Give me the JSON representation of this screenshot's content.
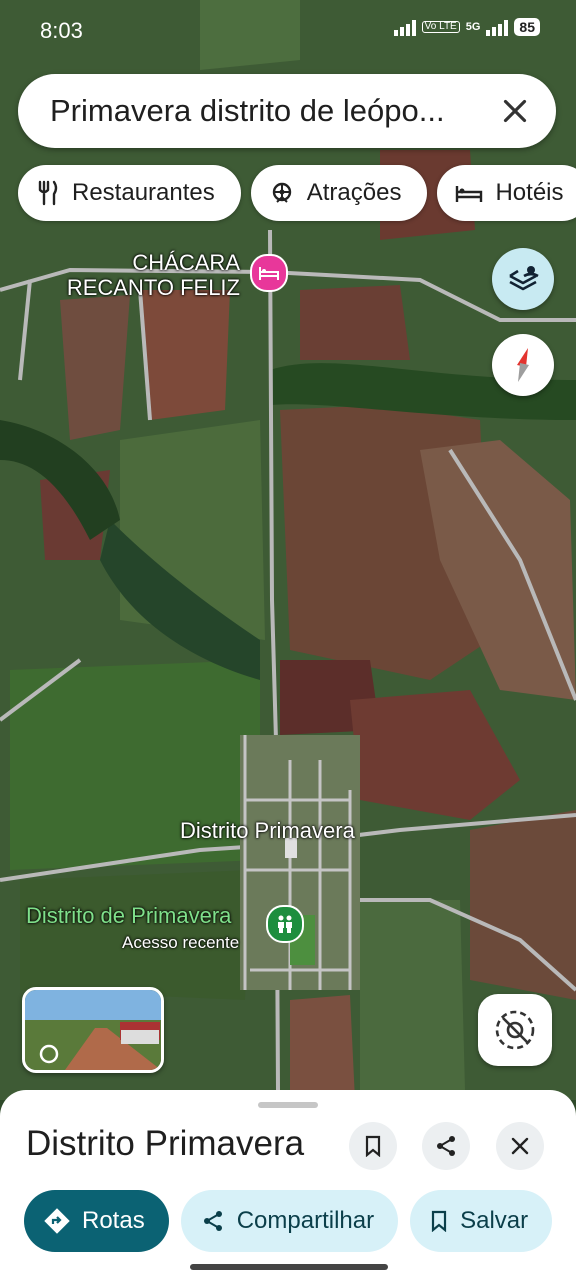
{
  "status": {
    "time": "8:03",
    "volte": "Vo LTE",
    "network": "5G",
    "battery": "85"
  },
  "search": {
    "query": "Primavera distrito de leópo..."
  },
  "chips": [
    {
      "label": "Restaurantes",
      "icon": "fork-knife-icon"
    },
    {
      "label": "Atrações",
      "icon": "attractions-icon"
    },
    {
      "label": "Hotéis",
      "icon": "bed-icon"
    }
  ],
  "map": {
    "poi_hotel": "CHÁCARA RECANTO FELIZ",
    "poi_hotel_line1": "CHÁCARA",
    "poi_hotel_line2": "RECANTO FELIZ",
    "town_label": "Distrito Primavera",
    "poi_park": "Distrito de Primavera",
    "poi_park_sub": "Acesso recente"
  },
  "sheet": {
    "title": "Distrito Primavera",
    "actions": {
      "rotas": "Rotas",
      "compartilhar": "Compartilhar",
      "salvar": "Salvar"
    }
  },
  "colors": {
    "primary": "#0b6273",
    "chip_bg": "#d7f1f8",
    "hotel_pin": "#e8379a",
    "park_pin": "#1e8e3e"
  }
}
